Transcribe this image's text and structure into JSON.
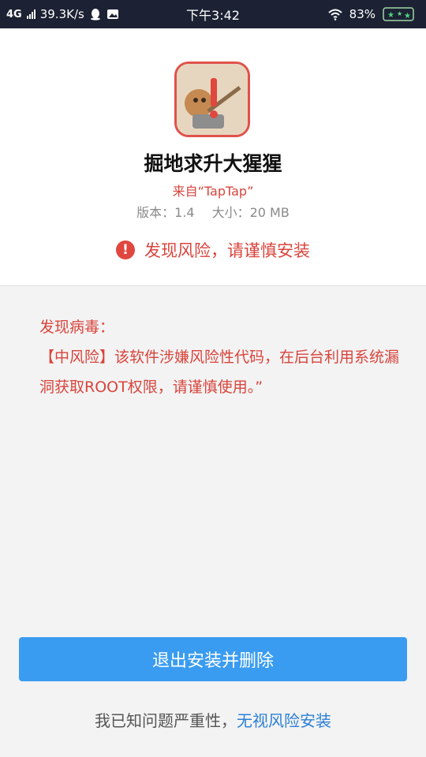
{
  "status_bar": {
    "network": "4G",
    "speed": "39.3K/s",
    "time": "下午3:42",
    "battery": "83%"
  },
  "app": {
    "icon": "app-icon-monkey-warning",
    "name": "掘地求升大猩猩",
    "source": "来自“TapTap”",
    "version": "版本：1.4",
    "size": "大小：20 MB"
  },
  "risk": {
    "icon": "exclamation-icon",
    "text": "发现风险，请谨慎安装"
  },
  "virus": {
    "title": "发现病毒：",
    "body": "【中风险】该软件涉嫌风险性代码，在后台利用系统漏洞获取ROOT权限，请谨慎使用。”"
  },
  "actions": {
    "exit_button": "退出安装并删除",
    "ignore_prefix": "我已知问题严重性，",
    "ignore_link": "无视风险安装"
  },
  "colors": {
    "status_bar_bg": "#1c2233",
    "warning_red": "#d9443c",
    "primary_blue": "#3a9cf0",
    "link_blue": "#2b7fd6"
  }
}
